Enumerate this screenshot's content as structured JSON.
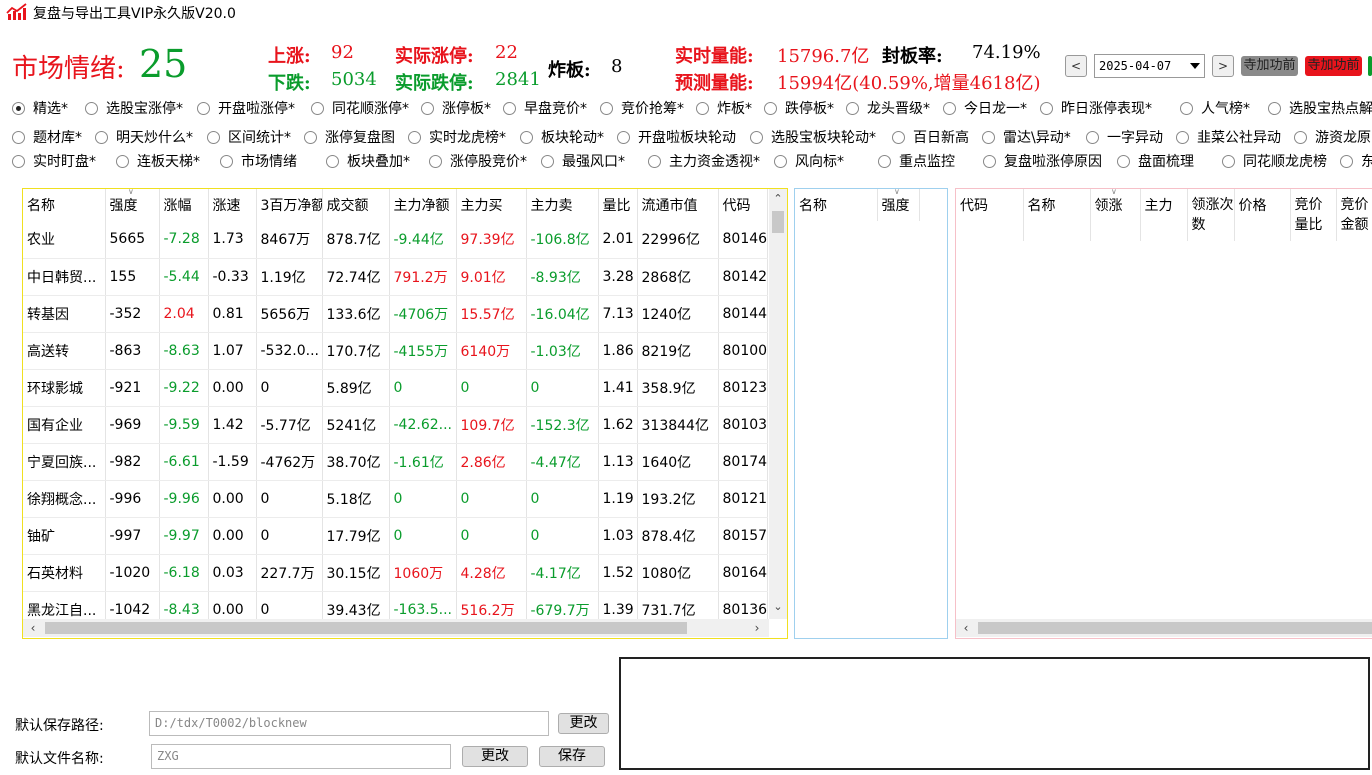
{
  "app": {
    "title": "复盘与导出工具VIP永久版V20.0"
  },
  "sentiment": {
    "label": "市场情绪:",
    "value": "25",
    "up_label": "上涨:",
    "up_value": "92",
    "down_label": "下跌:",
    "down_value": "5034",
    "limit_up_label": "实际涨停:",
    "limit_up_value": "22",
    "limit_down_label": "实际跌停:",
    "limit_down_value": "2841",
    "blown_label": "炸板:",
    "blown_value": "8",
    "volume_label": "实时量能:",
    "volume_value": "15796.7亿",
    "seal_label": "封板率:",
    "seal_value": "74.19%",
    "forecast_label": "预测量能:",
    "forecast_value": "15994亿(40.59%,增量4618亿)"
  },
  "toolbar": {
    "prev_label": "<",
    "date": "2025-04-07",
    "next_label": ">",
    "btn1_label": "寺加功前",
    "btn2_label": "寺加功前"
  },
  "tabs": {
    "row1": [
      "精选*",
      "选股宝涨停*",
      "开盘啦涨停*",
      "同花顺涨停*",
      "涨停板*",
      "早盘竞价*",
      "竞价抢筹*",
      "炸板*",
      "跌停板*",
      "龙头晋级*",
      "今日龙一*",
      "昨日涨停表现*",
      "人气榜*",
      "选股宝热点解"
    ],
    "row2": [
      "题材库*",
      "明天炒什么*",
      "区间统计*",
      "涨停复盘图",
      "实时龙虎榜*",
      "板块轮动*",
      "开盘啦板块轮动",
      "选股宝板块轮动*",
      "百日新高",
      "雷达\\异动*",
      "一字异动",
      "韭菜公社异动",
      "游资龙原"
    ],
    "row3": [
      "实时盯盘*",
      "连板天梯*",
      "市场情绪",
      "板块叠加*",
      "涨停股竞价*",
      "最强风口*",
      "主力资金透视*",
      "风向标*",
      "重点监控",
      "复盘啦涨停原因",
      "盘面梳理",
      "同花顺龙虎榜",
      "东"
    ]
  },
  "main_table": {
    "columns": [
      "名称",
      "强度",
      "涨幅",
      "涨速",
      "3百万净额",
      "成交额",
      "主力净额",
      "主力买",
      "主力卖",
      "量比",
      "流通市值",
      "代码"
    ],
    "rows": [
      [
        "农业",
        "5665",
        "-7.28",
        "1.73",
        "8467万",
        "878.7亿",
        "-9.44亿",
        "97.39亿",
        "-106.8亿",
        "2.01",
        "22996亿",
        "80146"
      ],
      [
        "中日韩贸...",
        "155",
        "-5.44",
        "-0.33",
        "1.19亿",
        "72.74亿",
        "791.2万",
        "9.01亿",
        "-8.93亿",
        "3.28",
        "2868亿",
        "80142"
      ],
      [
        "转基因",
        "-352",
        "2.04",
        "0.81",
        "5656万",
        "133.6亿",
        "-4706万",
        "15.57亿",
        "-16.04亿",
        "7.13",
        "1240亿",
        "80144"
      ],
      [
        "高送转",
        "-863",
        "-8.63",
        "1.07",
        "-532.0...",
        "170.7亿",
        "-4155万",
        "6140万",
        "-1.03亿",
        "1.86",
        "8219亿",
        "80100"
      ],
      [
        "环球影城",
        "-921",
        "-9.22",
        "0.00",
        "0",
        "5.89亿",
        "0",
        "0",
        "0",
        "1.41",
        "358.9亿",
        "80123"
      ],
      [
        "国有企业",
        "-969",
        "-9.59",
        "1.42",
        "-5.77亿",
        "5241亿",
        "-42.62...",
        "109.7亿",
        "-152.3亿",
        "1.62",
        "313844亿",
        "80103"
      ],
      [
        "宁夏回族...",
        "-982",
        "-6.61",
        "-1.59",
        "-4762万",
        "38.70亿",
        "-1.61亿",
        "2.86亿",
        "-4.47亿",
        "1.13",
        "1640亿",
        "80174"
      ],
      [
        "徐翔概念...",
        "-996",
        "-9.96",
        "0.00",
        "0",
        "5.18亿",
        "0",
        "0",
        "0",
        "1.19",
        "193.2亿",
        "80121"
      ],
      [
        "铀矿",
        "-997",
        "-9.97",
        "0.00",
        "0",
        "17.79亿",
        "0",
        "0",
        "0",
        "1.03",
        "878.4亿",
        "80157"
      ],
      [
        "石英材料",
        "-1020",
        "-6.18",
        "0.03",
        "227.7万",
        "30.15亿",
        "1060万",
        "4.28亿",
        "-4.17亿",
        "1.52",
        "1080亿",
        "80164"
      ],
      [
        "黑龙江自...",
        "-1042",
        "-8.43",
        "0.00",
        "0",
        "39.43亿",
        "-163.5...",
        "516.2万",
        "-679.7万",
        "1.39",
        "731.7亿",
        "80136"
      ]
    ]
  },
  "mid_table": {
    "columns": [
      "名称",
      "强度"
    ]
  },
  "right_table": {
    "columns": [
      "代码",
      "名称",
      "领涨",
      "主力",
      "领涨次数",
      "价格",
      "竞价量比",
      "竞价金额"
    ]
  },
  "footer": {
    "path_label": "默认保存路径:",
    "path_value": "D:/tdx/T0002/blocknew",
    "change1_label": "更改",
    "file_label": "默认文件名称:",
    "file_value": "ZXG",
    "change2_label": "更改",
    "save_label": "保存"
  },
  "colors": {
    "up": "#e8141c",
    "down": "#0a9c2c",
    "accent_panel": "#f0e020",
    "blue_panel": "#9fd0ee",
    "pink_panel": "#f6c0c8"
  }
}
